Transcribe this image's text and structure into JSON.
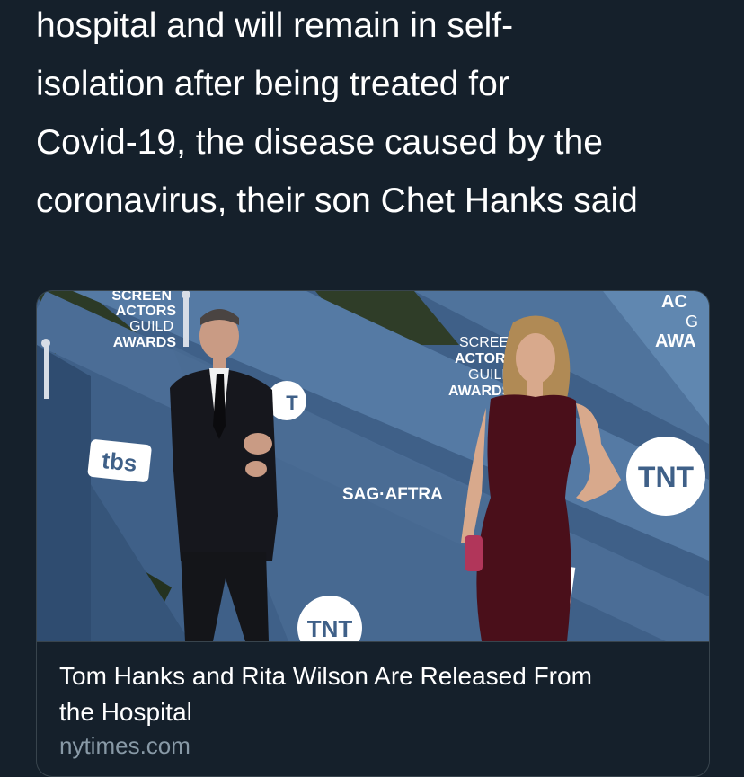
{
  "tweet": {
    "text_lines": [
      "hospital and will remain in self-",
      "isolation after being treated for",
      "Covid-19, the disease caused by the",
      "coronavirus, their son Chet Hanks said"
    ]
  },
  "link_card": {
    "image": {
      "backdrop_text": {
        "sag_logo_top_left": [
          "SCREEN",
          "ACTORS",
          "GUILD",
          "AWARDS"
        ],
        "sag_logo_center": [
          "SCREEN",
          "ACTORS",
          "GUILD",
          "AWARDS"
        ],
        "sag_logo_top_right": [
          "AC",
          "G",
          "AWA"
        ],
        "tbs_logo": "tbs",
        "sag_aftra": "SAG·AFTRA",
        "tnt_logo_right": "TNT",
        "tnt_logo_bottom": "TNT",
        "tnt_logo_partial": "T"
      }
    },
    "title_lines": [
      "Tom Hanks and Rita Wilson Are Released From",
      "the Hospital"
    ],
    "domain": "nytimes.com"
  },
  "colors": {
    "background": "#15202b",
    "text": "#ffffff",
    "muted": "#8899a6",
    "border": "#38444d",
    "backdrop_blue": "#3e5f86",
    "gown": "#4a0f1a",
    "suit": "#15161c"
  }
}
